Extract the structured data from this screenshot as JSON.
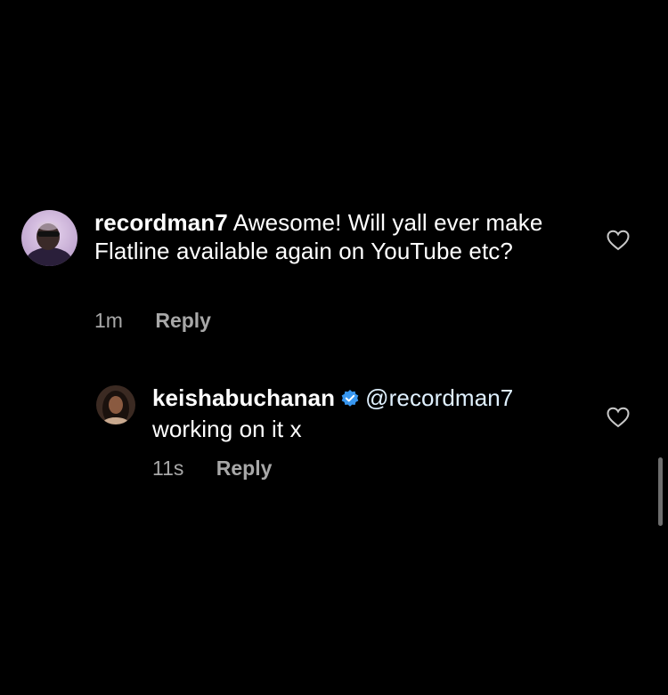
{
  "comments": [
    {
      "username": "recordman7",
      "verified": false,
      "text": "Awesome! Will yall ever make Flatline available again on YouTube etc?",
      "time": "1m",
      "reply_label": "Reply",
      "like_icon": "heart-outline-icon"
    },
    {
      "username": "keishabuchanan",
      "verified": true,
      "mention": "@recordman7",
      "text": "working on it x",
      "time": "11s",
      "reply_label": "Reply",
      "like_icon": "heart-outline-icon"
    }
  ],
  "colors": {
    "background": "#000000",
    "text": "#ffffff",
    "secondary_text": "#a8a8a8",
    "verified_badge": "#3897f0"
  }
}
